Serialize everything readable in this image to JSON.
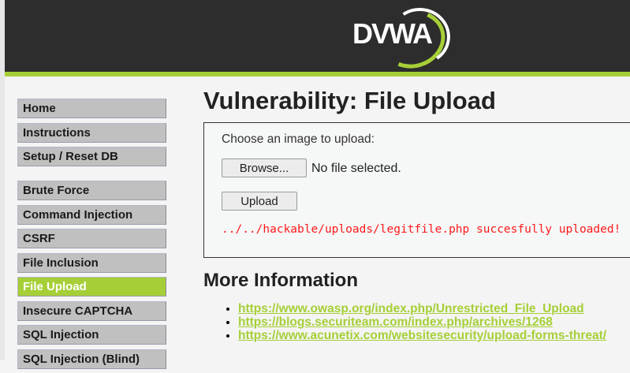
{
  "header": {
    "logo_text": "DVWA"
  },
  "colors": {
    "accent": "#a6cf37",
    "header_bg": "#2d2d2d",
    "message": "#ff1a1a"
  },
  "menu": {
    "group1": [
      {
        "label": "Home"
      },
      {
        "label": "Instructions"
      },
      {
        "label": "Setup / Reset DB"
      }
    ],
    "group2": [
      {
        "label": "Brute Force"
      },
      {
        "label": "Command Injection"
      },
      {
        "label": "CSRF"
      },
      {
        "label": "File Inclusion"
      },
      {
        "label": "File Upload",
        "active": true
      },
      {
        "label": "Insecure CAPTCHA"
      },
      {
        "label": "SQL Injection"
      },
      {
        "label": "SQL Injection (Blind)"
      }
    ]
  },
  "main": {
    "title": "Vulnerability: File Upload",
    "form": {
      "label": "Choose an image to upload:",
      "browse_label": "Browse...",
      "file_status": "No file selected.",
      "upload_label": "Upload",
      "message": "../../hackable/uploads/legitfile.php succesfully uploaded!"
    },
    "more_info_title": "More Information",
    "links": [
      "https://www.owasp.org/index.php/Unrestricted_File_Upload",
      "https://blogs.securiteam.com/index.php/archives/1268",
      "https://www.acunetix.com/websitesecurity/upload-forms-threat/"
    ]
  }
}
